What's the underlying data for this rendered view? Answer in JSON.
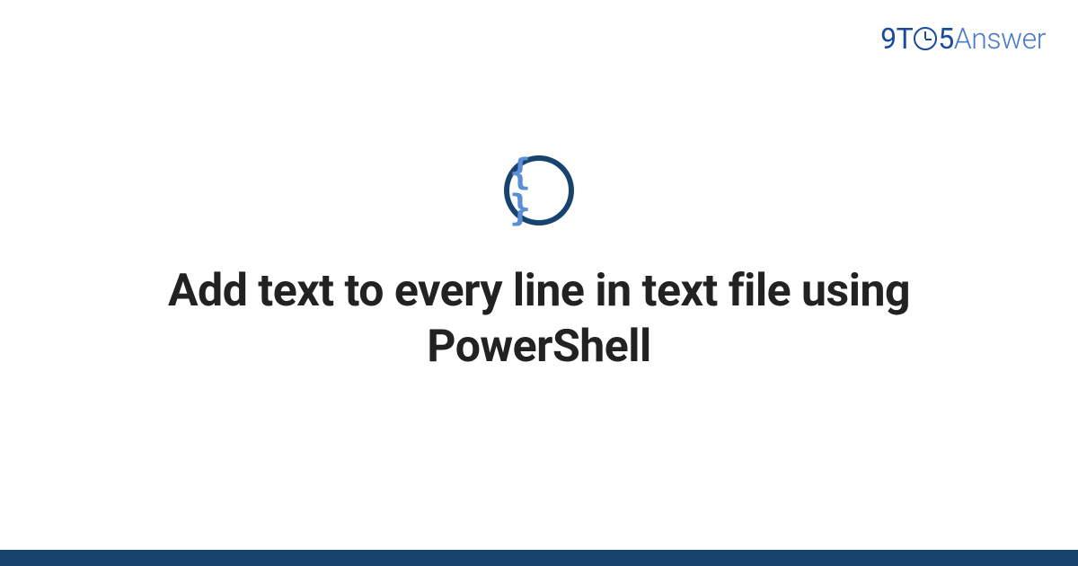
{
  "logo": {
    "part1": "9T",
    "part2": "5",
    "part3": "Answer"
  },
  "icon": {
    "symbol": "{ }",
    "name": "code-braces"
  },
  "heading": "Add text to every line in text file using PowerShell",
  "colors": {
    "dark_blue": "#18436f",
    "logo_blue": "#1a4a9e",
    "light_blue": "#5a8fd6",
    "text_dark": "#222222"
  }
}
